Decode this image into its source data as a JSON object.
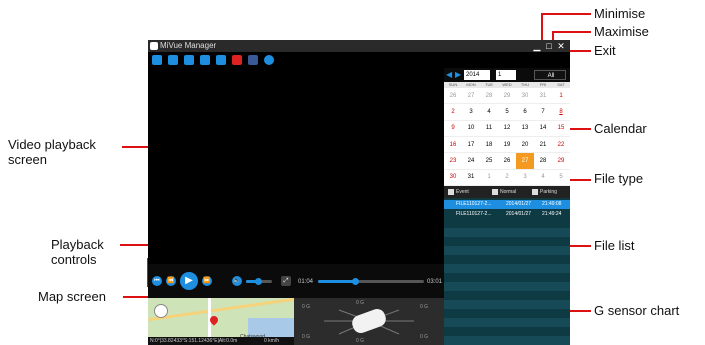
{
  "window": {
    "title": "MiVue Manager",
    "minimise_glyph": "▁",
    "maximise_glyph": "□",
    "close_glyph": "✕"
  },
  "toolbar": {
    "icons": [
      "folder-icon",
      "print-icon",
      "save-icon",
      "camera-icon",
      "gps-icon",
      "youtube-icon",
      "facebook-icon",
      "settings-icon"
    ]
  },
  "playback": {
    "elapsed": "01:04",
    "total": "03:01",
    "volume_level": 0.45,
    "progress": 0.35
  },
  "calendar": {
    "year": "2014",
    "month": "1",
    "all_label": "All",
    "weekdays": [
      "SUN",
      "MON",
      "TUE",
      "WED",
      "THU",
      "FRI",
      "SAT"
    ],
    "days": [
      {
        "d": "26",
        "t": "other"
      },
      {
        "d": "27",
        "t": "other"
      },
      {
        "d": "28",
        "t": "other"
      },
      {
        "d": "29",
        "t": "other"
      },
      {
        "d": "30",
        "t": "other"
      },
      {
        "d": "31",
        "t": "other"
      },
      {
        "d": "1",
        "t": "sun"
      },
      {
        "d": "2",
        "t": "sun"
      },
      {
        "d": "3",
        "t": ""
      },
      {
        "d": "4",
        "t": ""
      },
      {
        "d": "5",
        "t": ""
      },
      {
        "d": "6",
        "t": ""
      },
      {
        "d": "7",
        "t": ""
      },
      {
        "d": "8",
        "t": "has"
      },
      {
        "d": "9",
        "t": "sun"
      },
      {
        "d": "10",
        "t": ""
      },
      {
        "d": "11",
        "t": ""
      },
      {
        "d": "12",
        "t": ""
      },
      {
        "d": "13",
        "t": ""
      },
      {
        "d": "14",
        "t": ""
      },
      {
        "d": "15",
        "t": "sun"
      },
      {
        "d": "16",
        "t": "sun"
      },
      {
        "d": "17",
        "t": ""
      },
      {
        "d": "18",
        "t": ""
      },
      {
        "d": "19",
        "t": ""
      },
      {
        "d": "20",
        "t": ""
      },
      {
        "d": "21",
        "t": ""
      },
      {
        "d": "22",
        "t": "sun"
      },
      {
        "d": "23",
        "t": "sun"
      },
      {
        "d": "24",
        "t": ""
      },
      {
        "d": "25",
        "t": ""
      },
      {
        "d": "26",
        "t": ""
      },
      {
        "d": "27",
        "t": "sel"
      },
      {
        "d": "28",
        "t": ""
      },
      {
        "d": "29",
        "t": "sun"
      },
      {
        "d": "30",
        "t": "sun"
      },
      {
        "d": "31",
        "t": ""
      },
      {
        "d": "1",
        "t": "other"
      },
      {
        "d": "2",
        "t": "other"
      },
      {
        "d": "3",
        "t": "other"
      },
      {
        "d": "4",
        "t": "other"
      },
      {
        "d": "5",
        "t": "other"
      }
    ]
  },
  "file_types": [
    "Event",
    "Normal",
    "Parking"
  ],
  "files": [
    {
      "name": "FILE110127-2...",
      "date": "2014/01/27",
      "time": "21:49:08",
      "selected": true
    },
    {
      "name": "FILE110127-2...",
      "date": "2014/01/27",
      "time": "21:49:24",
      "selected": false
    }
  ],
  "map": {
    "status": "N:0°|33.82433°S:151.12436°E|Alt:0.0m",
    "speed": "0 km/h",
    "place": "Chatswood"
  },
  "gsensor": {
    "labels": [
      "0 G",
      "0 G",
      "0 G",
      "0 G",
      "0 G",
      "0 G"
    ]
  },
  "callouts": {
    "minimise": "Minimise",
    "maximise": "Maximise",
    "exit": "Exit",
    "video": "Video playback\nscreen",
    "calendar": "Calendar",
    "file_type": "File type",
    "playback_controls": "Playback\ncontrols",
    "file_list": "File list",
    "map_screen": "Map screen",
    "g_sensor": "G sensor chart"
  }
}
